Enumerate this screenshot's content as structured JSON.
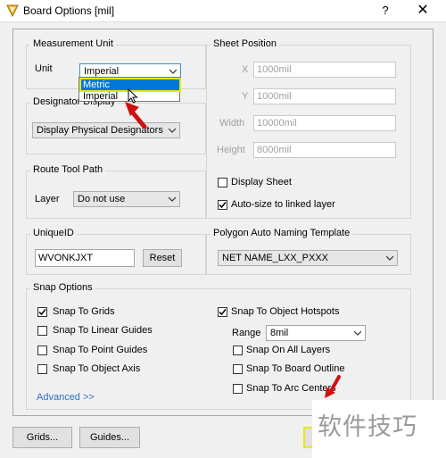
{
  "window": {
    "title": "Board Options [mil]",
    "help_label": "?",
    "close_label": "✕"
  },
  "measurement": {
    "legend": "Measurement Unit",
    "unit_label": "Unit",
    "unit_value": "Imperial",
    "options": [
      "Metric",
      "Imperial"
    ],
    "highlighted_option": "Metric"
  },
  "designator": {
    "legend": "Designator Display",
    "value": "Display Physical Designators"
  },
  "route": {
    "legend": "Route Tool Path",
    "layer_label": "Layer",
    "layer_value": "Do not use"
  },
  "unique_id": {
    "legend": "UniqueID",
    "value": "WVONKJXT",
    "reset_label": "Reset"
  },
  "sheet": {
    "legend": "Sheet Position",
    "x_label": "X",
    "x_value": "1000mil",
    "y_label": "Y",
    "y_value": "1000mil",
    "width_label": "Width",
    "width_value": "10000mil",
    "height_label": "Height",
    "height_value": "8000mil",
    "display_sheet_label": "Display Sheet",
    "display_sheet_checked": false,
    "autosize_label": "Auto-size to linked layer",
    "autosize_checked": true
  },
  "polygon": {
    "legend": "Polygon Auto Naming Template",
    "value": "NET NAME_LXX_PXXX"
  },
  "snap": {
    "legend": "Snap Options",
    "left": [
      {
        "label": "Snap To Grids",
        "checked": true
      },
      {
        "label": "Snap To Linear Guides",
        "checked": false
      },
      {
        "label": "Snap To Point Guides",
        "checked": false
      },
      {
        "label": "Snap To Object Axis",
        "checked": false
      }
    ],
    "advanced_label": "Advanced >>",
    "hotspots_label": "Snap To Object Hotspots",
    "hotspots_checked": true,
    "range_label": "Range",
    "range_value": "8mil",
    "right": [
      {
        "label": "Snap On All Layers",
        "checked": false
      },
      {
        "label": "Snap To Board Outline",
        "checked": false
      },
      {
        "label": "Snap To Arc Centers",
        "checked": false
      }
    ]
  },
  "footer": {
    "grids_label": "Grids...",
    "guides_label": "Guides..."
  },
  "watermark": {
    "text": "软件技巧"
  },
  "colors": {
    "accent": "#0078d7",
    "highlight": "#e8e800",
    "arrow": "#d01010"
  }
}
